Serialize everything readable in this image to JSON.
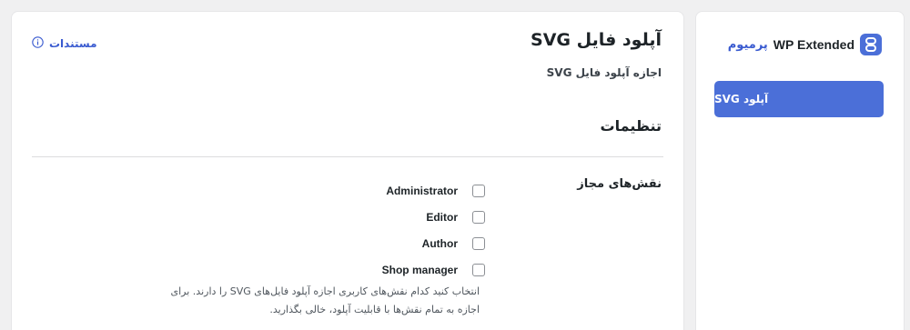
{
  "sidebar": {
    "brand_name": "WP Extended",
    "brand_badge": "پرمیوم",
    "items": [
      {
        "label": "آپلود SVG",
        "active": true
      }
    ],
    "accent_color": "#4b6fd8"
  },
  "main": {
    "title": "آپلود فایل SVG",
    "subtitle": "اجازه آپلود فایل SVG",
    "docs_label": "مستندات",
    "section_title": "تنظیمات",
    "field": {
      "label": "نقش‌های مجاز",
      "roles": [
        {
          "label": "Administrator",
          "checked": false
        },
        {
          "label": "Editor",
          "checked": false
        },
        {
          "label": "Author",
          "checked": false
        },
        {
          "label": "Shop manager",
          "checked": false
        }
      ],
      "help": "انتخاب کنید کدام نقش‌های کاربری اجازه آپلود فایل‌های SVG را دارند. برای اجازه به تمام نقش‌ها با قابلیت آپلود، خالی بگذارید."
    }
  }
}
